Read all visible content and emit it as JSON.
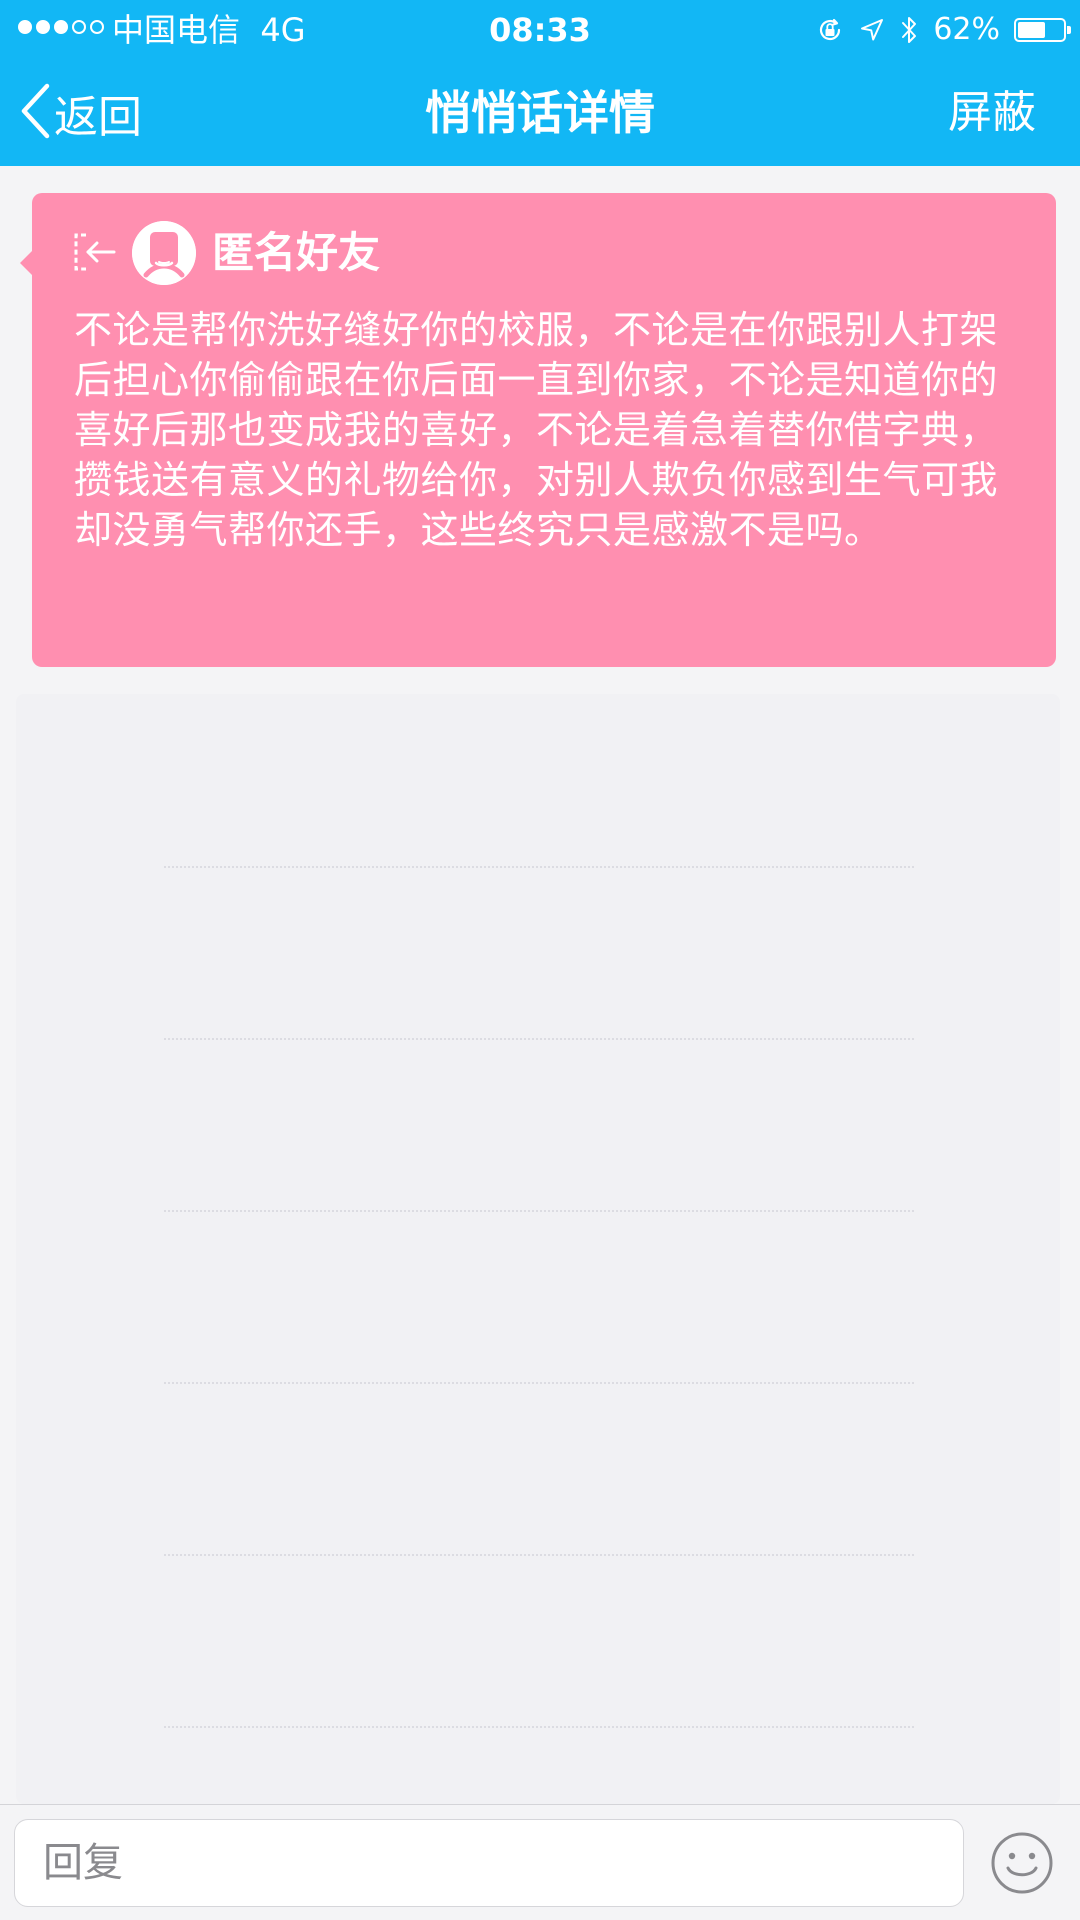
{
  "status_bar": {
    "carrier": "中国电信",
    "network": "4G",
    "time": "08:33",
    "battery_percent": "62%",
    "battery_level": 0.62,
    "signal_bars_filled": 3,
    "signal_bars_total": 5
  },
  "nav": {
    "back_label": "返回",
    "title": "悄悄话详情",
    "block_label": "屏蔽"
  },
  "message": {
    "sender": "匿名好友",
    "text": "不论是帮你洗好缝好你的校服，不论是在你跟别人打架后担心你偷偷跟在你后面一直到你家，不论是知道你的喜好后那也变成我的喜好，不论是着急着替你借字典，攒钱送有意义的礼物给你，对别人欺负你感到生气可我却没勇气帮你还手，这些终究只是感激不是吗。",
    "card_color": "#ff8fb0"
  },
  "reply": {
    "placeholder": "回复",
    "value": ""
  },
  "colors": {
    "header": "#12b7f5",
    "background": "#f4f4f6"
  },
  "icons": {
    "status": [
      "orientation-lock-icon",
      "location-icon",
      "bluetooth-icon",
      "battery-icon"
    ],
    "back": "chevron-left-icon",
    "exit": "exit-icon",
    "avatar": "anonymous-avatar-icon",
    "emoji": "smiley-icon"
  }
}
